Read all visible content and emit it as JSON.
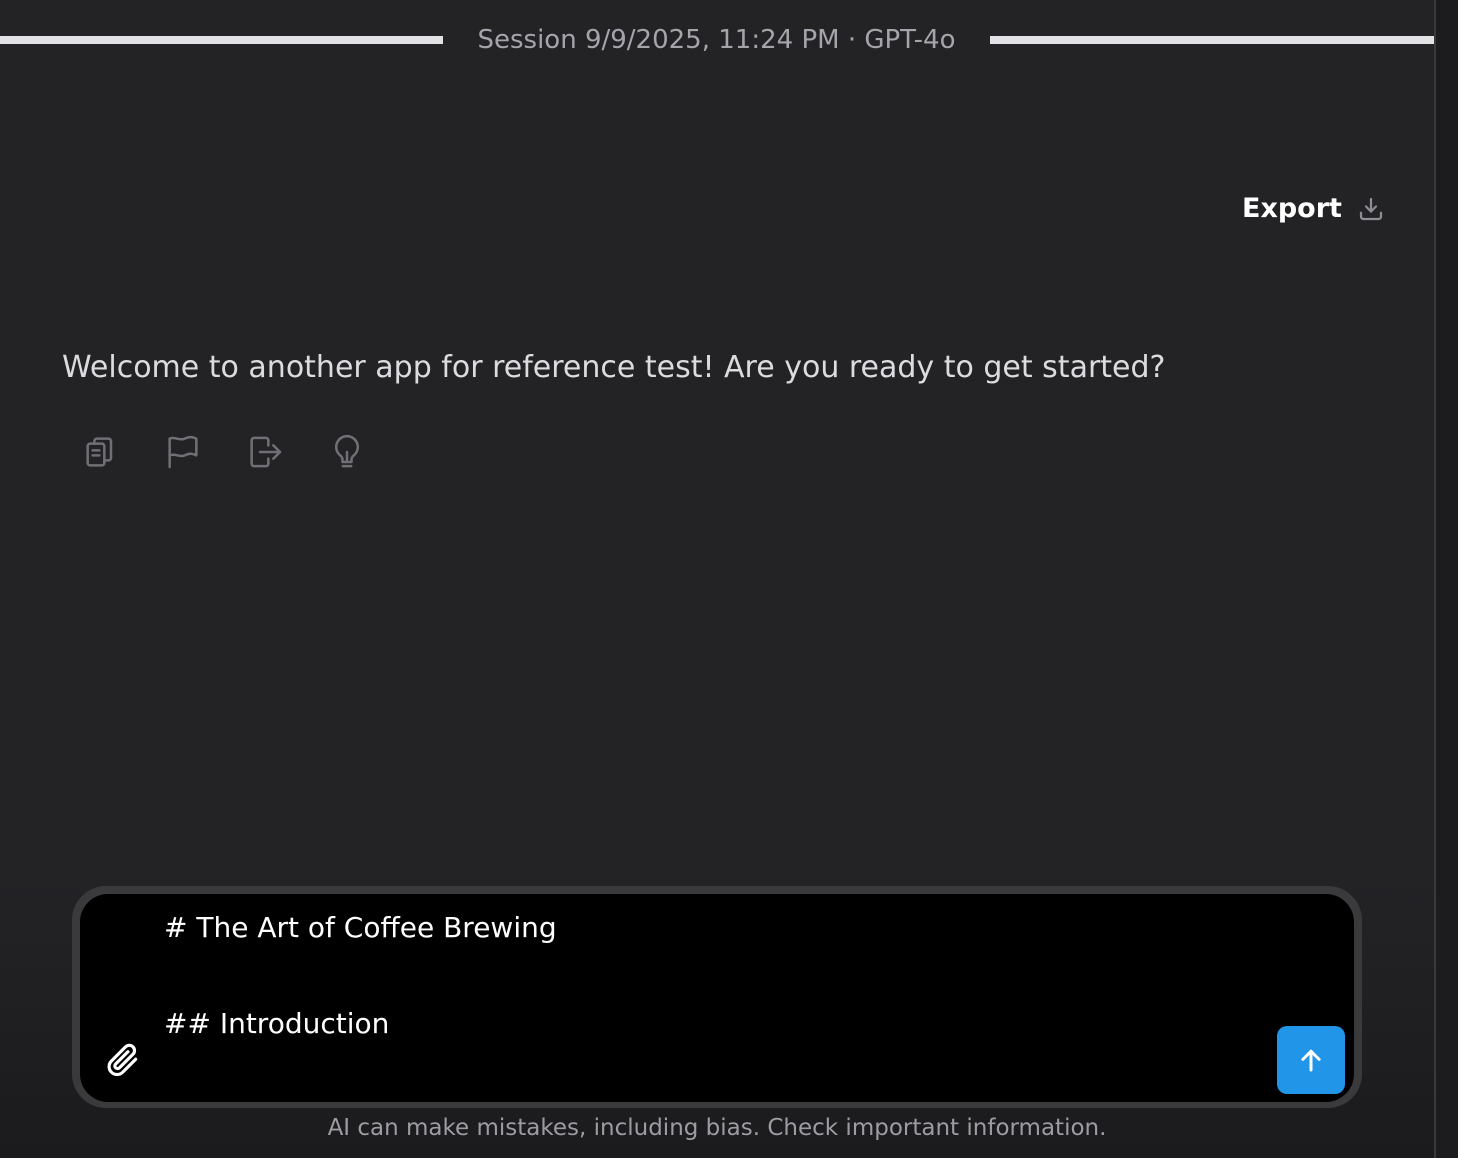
{
  "header": {
    "session_title": "Session 9/9/2025, 11:24 PM · GPT-4o"
  },
  "toolbar": {
    "export_label": "Export",
    "export_icon": "download-icon"
  },
  "conversation": {
    "messages": [
      {
        "role": "assistant",
        "text": "Welcome to another app for reference test! Are you ready to get started?",
        "actions": [
          {
            "icon": "copy-icon"
          },
          {
            "icon": "flag-icon"
          },
          {
            "icon": "share-icon"
          },
          {
            "icon": "lightbulb-icon"
          }
        ]
      }
    ]
  },
  "composer": {
    "value": "# The Art of Coffee Brewing\n\n## Introduction",
    "attach_icon": "paperclip-icon",
    "send_icon": "arrow-up-icon"
  },
  "footer": {
    "disclaimer": "AI can make mistakes, including bias. Check important information."
  },
  "colors": {
    "background": "#232326",
    "send_button": "#2196e8",
    "composer_bg": "#000000"
  }
}
